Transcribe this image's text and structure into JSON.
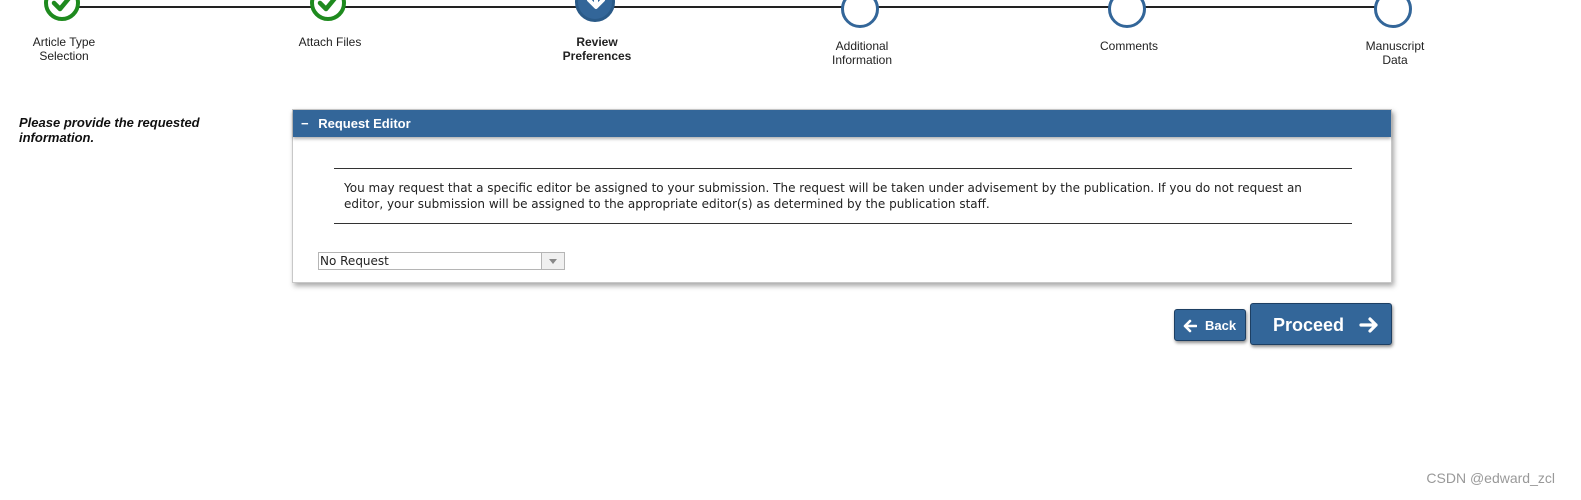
{
  "progress": {
    "steps": [
      {
        "label_line1": "Article Type",
        "label_line2": "Selection",
        "status": "done"
      },
      {
        "label_line1": "Attach Files",
        "label_line2": "",
        "status": "done"
      },
      {
        "label_line1": "Review",
        "label_line2": "Preferences",
        "status": "current"
      },
      {
        "label_line1": "Additional",
        "label_line2": "Information",
        "status": "pending"
      },
      {
        "label_line1": "Comments",
        "label_line2": "",
        "status": "pending"
      },
      {
        "label_line1": "Manuscript",
        "label_line2": "Data",
        "status": "pending"
      }
    ]
  },
  "instruction": {
    "text": "Please provide the requested information."
  },
  "panel": {
    "collapse_symbol": "−",
    "title": "Request Editor",
    "notice": "You may request that a specific editor be assigned to your submission. The request will be taken under advisement by the publication. If you do not request an editor, your submission will be assigned to the appropriate editor(s) as determined by the publication staff.",
    "editor_select": {
      "selected": "No Request"
    }
  },
  "buttons": {
    "back": "Back",
    "proceed": "Proceed"
  },
  "watermark": "CSDN @edward_zcl",
  "colors": {
    "accent": "#336699",
    "done": "#1e8a1e"
  }
}
